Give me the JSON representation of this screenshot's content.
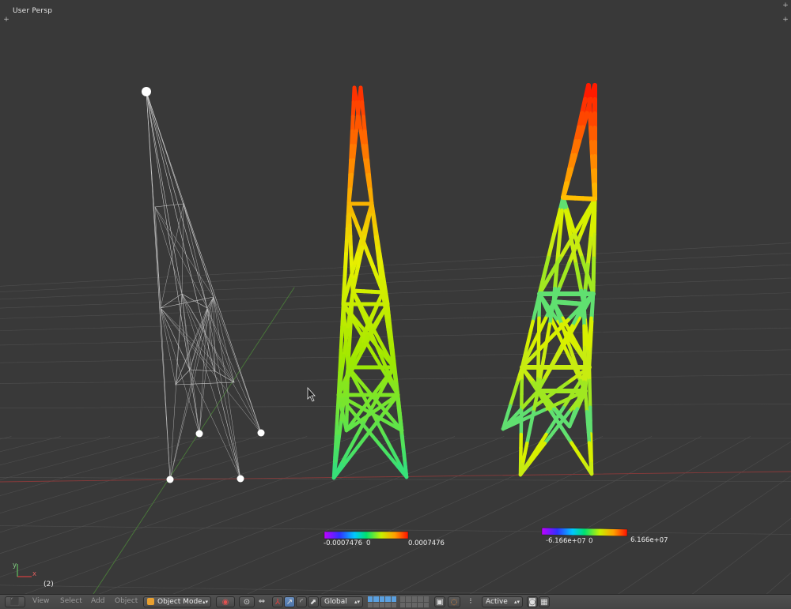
{
  "viewport": {
    "label": "User Persp",
    "frame": "(2)",
    "axis_x": "x",
    "axis_y": "y",
    "corner_icon": "+"
  },
  "legends": [
    {
      "min": "-0.0007476",
      "zero": "0",
      "max": "0.0007476"
    },
    {
      "min": "-6.166e+07",
      "zero": "0",
      "max": "6.166e+07"
    }
  ],
  "header": {
    "menus": [
      "View",
      "Select",
      "Add",
      "Object"
    ],
    "mode": "Object Mode",
    "orientation": "Global",
    "pivot": "Active"
  },
  "colors": {
    "viewport_bg": "#393939",
    "grid": "#4e4e4e",
    "x_axis": "#8a3a3a",
    "y_axis": "#4a7a3a",
    "wire": "#c8c8c8",
    "header_bg": "#4a4a4a",
    "active_blue": "#5680c2"
  }
}
